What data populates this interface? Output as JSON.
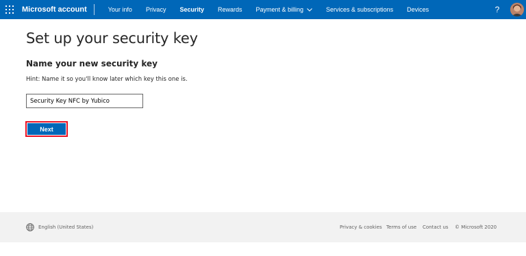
{
  "header": {
    "brand": "Microsoft account",
    "nav": [
      {
        "label": "Your info"
      },
      {
        "label": "Privacy"
      },
      {
        "label": "Security"
      },
      {
        "label": "Rewards"
      },
      {
        "label": "Payment & billing"
      },
      {
        "label": "Services & subscriptions"
      },
      {
        "label": "Devices"
      }
    ],
    "active_nav": "Security",
    "help_label": "?",
    "accent_color": "#0067b8"
  },
  "main": {
    "title": "Set up your security key",
    "subheading": "Name your new security key",
    "hint": "Hint: Name it so you'll know later which key this one is.",
    "key_name_value": "Security Key NFC by Yubico",
    "next_label": "Next",
    "highlight_color": "#e81123"
  },
  "footer": {
    "locale": "English (United States)",
    "links": {
      "privacy": "Privacy & cookies",
      "terms": "Terms of use",
      "contact": "Contact us",
      "copyright": "© Microsoft 2020"
    }
  }
}
